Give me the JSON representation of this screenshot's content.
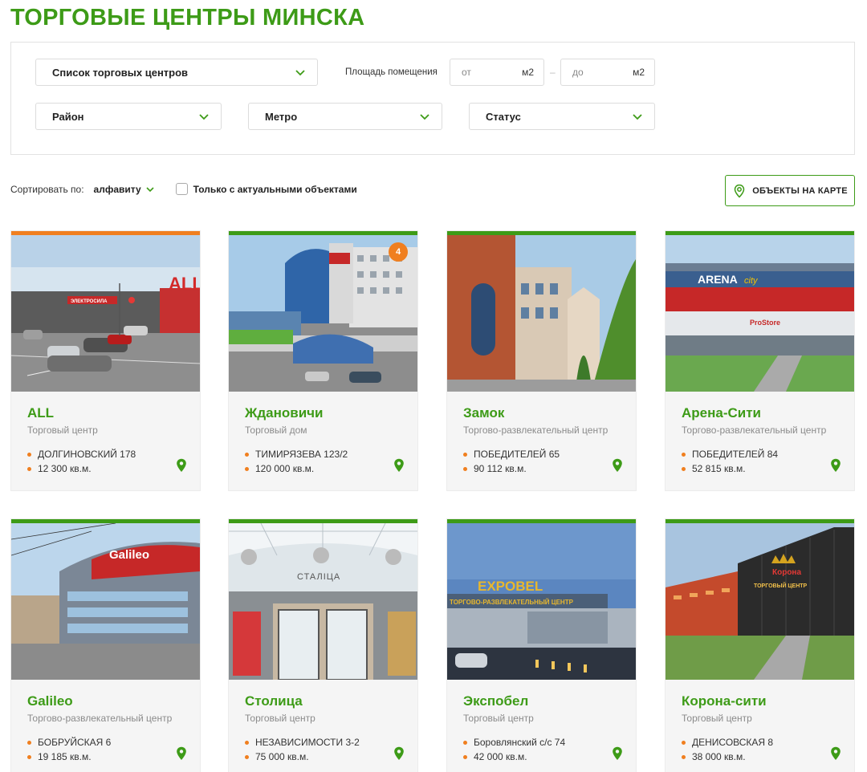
{
  "page_title": "ТОРГОВЫЕ ЦЕНТРЫ МИНСКА",
  "filters": {
    "mall_list": "Список торговых центров",
    "area_label": "Площадь помещения",
    "area_from_placeholder": "от",
    "area_to_placeholder": "до",
    "area_unit": "м2",
    "district": "Район",
    "metro": "Метро",
    "status": "Статус",
    "range_dash": "–"
  },
  "sort": {
    "label": "Сортировать по:",
    "value": "алфавиту",
    "only_actual": "Только с актуальными объектами"
  },
  "map_button": "ОБЪЕКТЫ НА КАРТЕ",
  "colors": {
    "accent": "#3d9b17",
    "orange": "#f07f1f"
  },
  "cards": [
    {
      "name": "ALL",
      "type": "Торговый центр",
      "address": "ДОЛГИНОВСКИЙ 178",
      "area": "12 300 кв.м.",
      "bar": "orange"
    },
    {
      "name": "Ждановичи",
      "type": "Торговый дом",
      "address": "ТИМИРЯЗЕВА 123/2",
      "area": "120 000 кв.м.",
      "bar": "green",
      "badge": "4"
    },
    {
      "name": "Замок",
      "type": "Торгово-развлекательный центр",
      "address": "ПОБЕДИТЕЛЕЙ 65",
      "area": "90 112 кв.м.",
      "bar": "green"
    },
    {
      "name": "Арена-Сити",
      "type": "Торгово-развлекательный центр",
      "address": "ПОБЕДИТЕЛЕЙ 84",
      "area": "52 815 кв.м.",
      "bar": "green"
    },
    {
      "name": "Galileo",
      "type": "Торгово-развлекательный центр",
      "address": "БОБРУЙСКАЯ 6",
      "area": "19 185 кв.м.",
      "bar": "green"
    },
    {
      "name": "Столица",
      "type": "Торговый центр",
      "address": "НЕЗАВИСИМОСТИ 3-2",
      "area": "75 000 кв.м.",
      "bar": "green"
    },
    {
      "name": "Экспобел",
      "type": "Торговый центр",
      "address": "Боровлянский с/с 74",
      "area": "42 000 кв.м.",
      "bar": "green"
    },
    {
      "name": "Корона-сити",
      "type": "Торговый центр",
      "address": "ДЕНИСОВСКАЯ 8",
      "area": "38 000 кв.м.",
      "bar": "green"
    }
  ],
  "photo_signs": {
    "all_big": "ALL",
    "all_store": "ЭЛЕКТРОСИЛА",
    "arena": "ARENA",
    "arena_city": "city",
    "arena_prostore": "ProStore",
    "galileo": "Galileo",
    "stolica": "СТАЛІЦА",
    "expobel": "EXPOBEL",
    "expobel_sub": "ТОРГОВО-РАЗВЛЕКАТЕЛЬНЫЙ ЦЕНТР",
    "korona": "Корона",
    "korona_sub": "ТОРГОВЫЙ ЦЕНТР"
  }
}
